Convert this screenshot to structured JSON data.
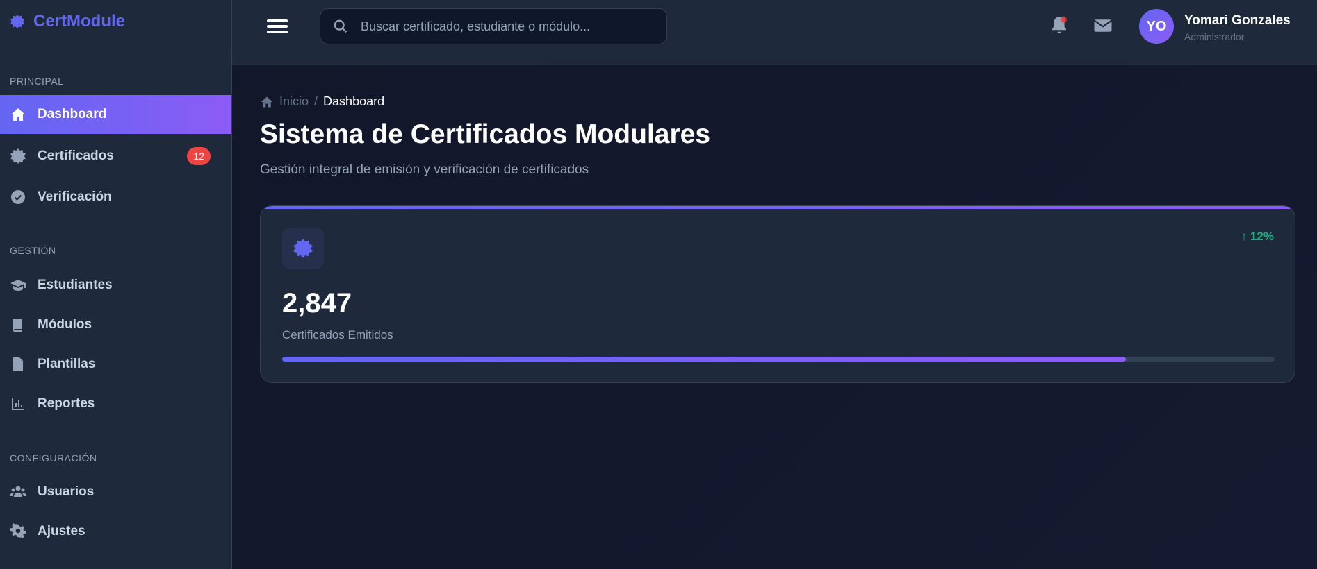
{
  "app": {
    "name": "CertModule"
  },
  "sidebar": {
    "sections": [
      "PRINCIPAL",
      "GESTIÓN",
      "CONFIGURACIÓN"
    ],
    "items": [
      {
        "label": "Dashboard"
      },
      {
        "label": "Certificados",
        "badge": "12"
      },
      {
        "label": "Verificación"
      },
      {
        "label": "Estudiantes"
      },
      {
        "label": "Módulos"
      },
      {
        "label": "Plantillas"
      },
      {
        "label": "Reportes"
      },
      {
        "label": "Usuarios"
      },
      {
        "label": "Ajustes"
      }
    ]
  },
  "header": {
    "search_placeholder": "Buscar certificado, estudiante o módulo...",
    "user": {
      "initials": "YO",
      "name": "Yomari Gonzales",
      "role": "Administrador"
    }
  },
  "breadcrumb": {
    "home": "Inicio",
    "sep": "/",
    "current": "Dashboard"
  },
  "page": {
    "title": "Sistema de Certificados Modulares",
    "subtitle": "Gestión integral de emisión y verificación de certificados"
  },
  "stat": {
    "value": "2,847",
    "label": "Certificados Emitidos",
    "trend": "↑ 12%",
    "progress_percent": 85
  },
  "colors": {
    "accent": "#6366f1",
    "accent2": "#8b5cf6",
    "success": "#10b981",
    "danger": "#ef4444"
  }
}
